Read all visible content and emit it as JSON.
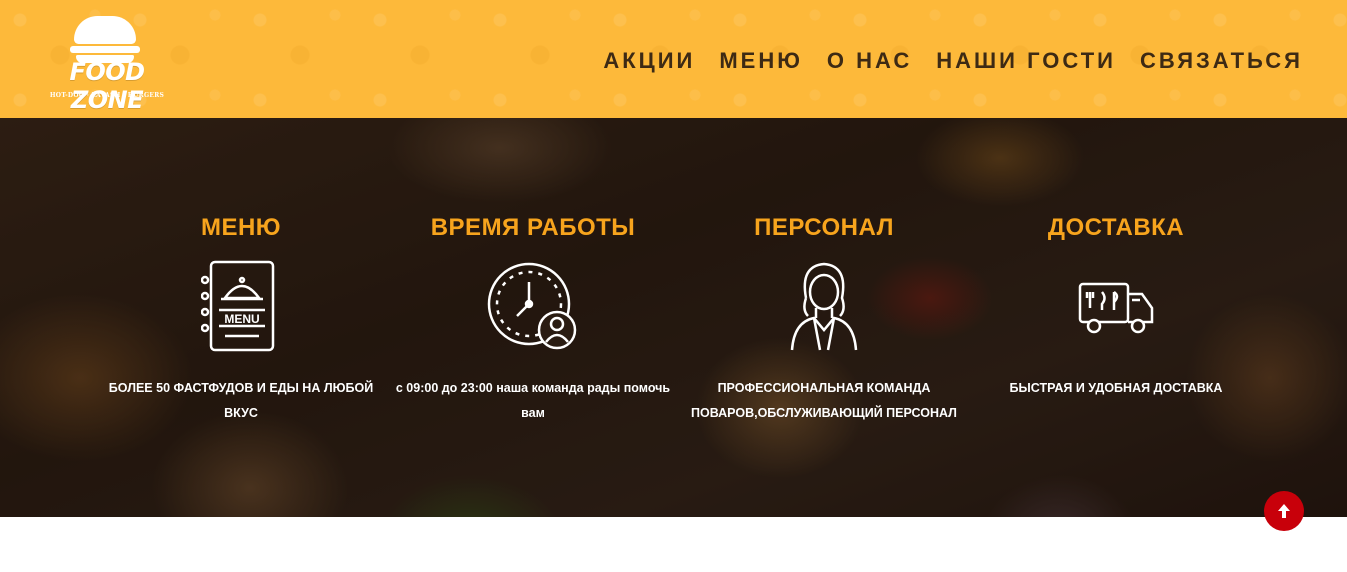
{
  "logo": {
    "name": "FOOD ZONE",
    "tagline": "HOT-DOG · LAVASH · BURGERS"
  },
  "nav": {
    "items": [
      "АКЦИИ",
      "МЕНЮ",
      "О НАС",
      "НАШИ ГОСТИ",
      "СВЯЗАТЬСЯ"
    ]
  },
  "features": [
    {
      "title": "МЕНЮ",
      "icon": "menu-cloche-icon",
      "icon_text": "MENU",
      "description": "БОЛЕЕ 50 ФАСТФУДОВ И ЕДЫ НА ЛЮБОЙ ВКУС"
    },
    {
      "title": "ВРЕМЯ РАБОТЫ",
      "icon": "clock-person-icon",
      "description": "с 09:00 до 23:00 наша команда рады помочь вам"
    },
    {
      "title": "ПЕРСОНАЛ",
      "icon": "staff-person-icon",
      "description": "ПРОФЕССИОНАЛЬНАЯ КОМАНДА ПОВАРОВ,ОБСЛУЖИВАЮЩИЙ ПЕРСОНАЛ"
    },
    {
      "title": "ДОСТАВКА",
      "icon": "delivery-truck-icon",
      "description": "БЫСТРАЯ И УДОБНАЯ ДОСТАВКА"
    }
  ],
  "scroll_top": {
    "icon": "arrow-up-icon"
  },
  "colors": {
    "header_bg": "#fdb93a",
    "nav_text": "#3d2a14",
    "feature_title": "#f7a41d",
    "scroll_button": "#c8000a"
  }
}
